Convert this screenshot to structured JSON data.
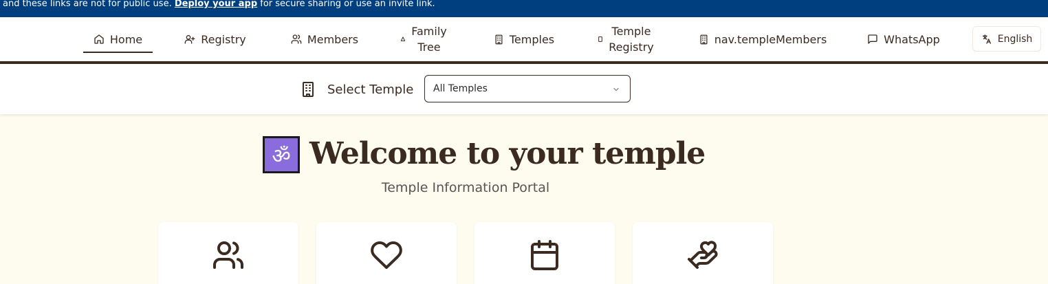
{
  "banner": {
    "text_before": "and these links are not for public use. ",
    "link_text": "Deploy your app",
    "text_after": " for secure sharing or use an invite link."
  },
  "nav": {
    "items": [
      {
        "label": "Home",
        "icon": "home-icon"
      },
      {
        "label": "Registry",
        "icon": "user-plus-icon"
      },
      {
        "label": "Members",
        "icon": "users-icon"
      },
      {
        "label": "Family\nTree",
        "icon": "family-tree-icon"
      },
      {
        "label": "Temples",
        "icon": "building-icon"
      },
      {
        "label": "Temple\nRegistry",
        "icon": "building-icon"
      },
      {
        "label": "nav.templeMembers",
        "icon": "building-icon"
      },
      {
        "label": "WhatsApp",
        "icon": "message-icon"
      }
    ],
    "language": "English"
  },
  "temple_select": {
    "label": "Select Temple",
    "value": "All Temples"
  },
  "hero": {
    "icon_symbol": "ॐ",
    "title": "Welcome to your temple",
    "subtitle": "Temple Information Portal"
  },
  "cards": [
    {
      "icon": "users-icon"
    },
    {
      "icon": "heart-icon"
    },
    {
      "icon": "calendar-icon"
    },
    {
      "icon": "hand-heart-icon"
    }
  ],
  "colors": {
    "banner_bg": "#003f7f",
    "brand_brown": "#3a2a20",
    "page_bg": "#fefcef",
    "om_bg": "#8b6cdc"
  }
}
